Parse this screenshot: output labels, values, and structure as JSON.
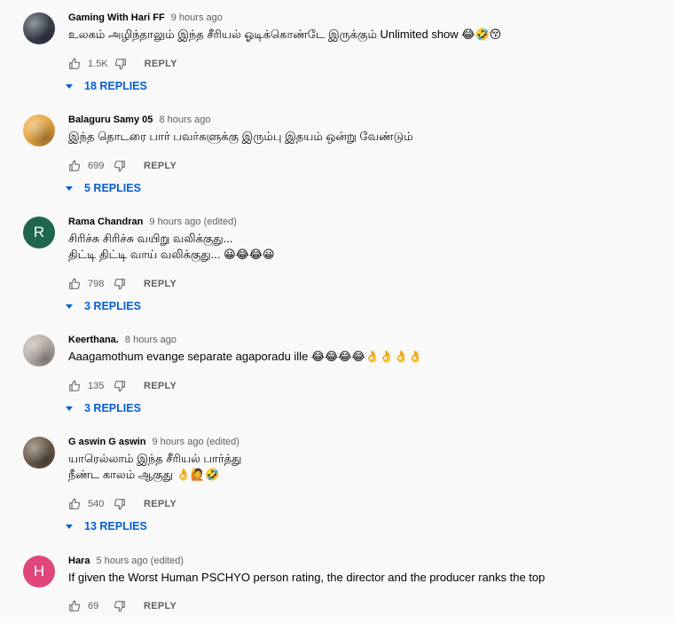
{
  "like_icon": "thumb-up-icon",
  "dislike_icon": "thumb-down-icon",
  "comments": [
    {
      "author": "Gaming With Hari FF",
      "time": "9 hours ago",
      "text": "உலகம் அழிந்தாலும் இந்த சீரியல் ஓடிக்கொண்டே இருக்கும் Unlimited show 😂🤣😚",
      "likes": "1.5K",
      "reply_label": "REPLY",
      "replies": "18 REPLIES",
      "avatar_letter": "",
      "avatar_color": "#3b4250"
    },
    {
      "author": "Balaguru Samy 05",
      "time": "8 hours ago",
      "text": "இந்த தொடரை பார் பவர்களுக்கு  இரும்பு இதயம் ஒன்று வேண்டும்",
      "likes": "699",
      "reply_label": "REPLY",
      "replies": "5 REPLIES",
      "avatar_letter": "",
      "avatar_color": "#e9a640"
    },
    {
      "author": "Rama Chandran",
      "time": "9 hours ago (edited)",
      "text": "சிரிச்சு சிரிச்சு வயிறு வலிக்குது...\nதிட்டி திட்டி வாய் வலிக்குது... 😀😂😂😀",
      "likes": "798",
      "reply_label": "REPLY",
      "replies": "3 REPLIES",
      "avatar_letter": "R",
      "avatar_color": "#1e6650"
    },
    {
      "author": "Keerthana.",
      "time": "8 hours ago",
      "text": "Aaagamothum evange separate agaporadu ille 😂😂😂😂👌👌👌👌",
      "likes": "135",
      "reply_label": "REPLY",
      "replies": "3 REPLIES",
      "avatar_letter": "",
      "avatar_color": "#b9b0aa"
    },
    {
      "author": "G aswin G aswin",
      "time": "9 hours ago (edited)",
      "text": "யாரெல்லாம் இந்த சீரியல் பார்த்து\nநீண்ட காலம் ஆகுது 👌🙋🤣",
      "likes": "540",
      "reply_label": "REPLY",
      "replies": "13 REPLIES",
      "avatar_letter": "",
      "avatar_color": "#6b5a48"
    },
    {
      "author": "Hara",
      "time": "5 hours ago (edited)",
      "text": "If given the  Worst Human PSCHYO person rating, the director and the producer ranks the top",
      "likes": "69",
      "reply_label": "REPLY",
      "replies": "",
      "avatar_letter": "H",
      "avatar_color": "#e0457b"
    }
  ]
}
